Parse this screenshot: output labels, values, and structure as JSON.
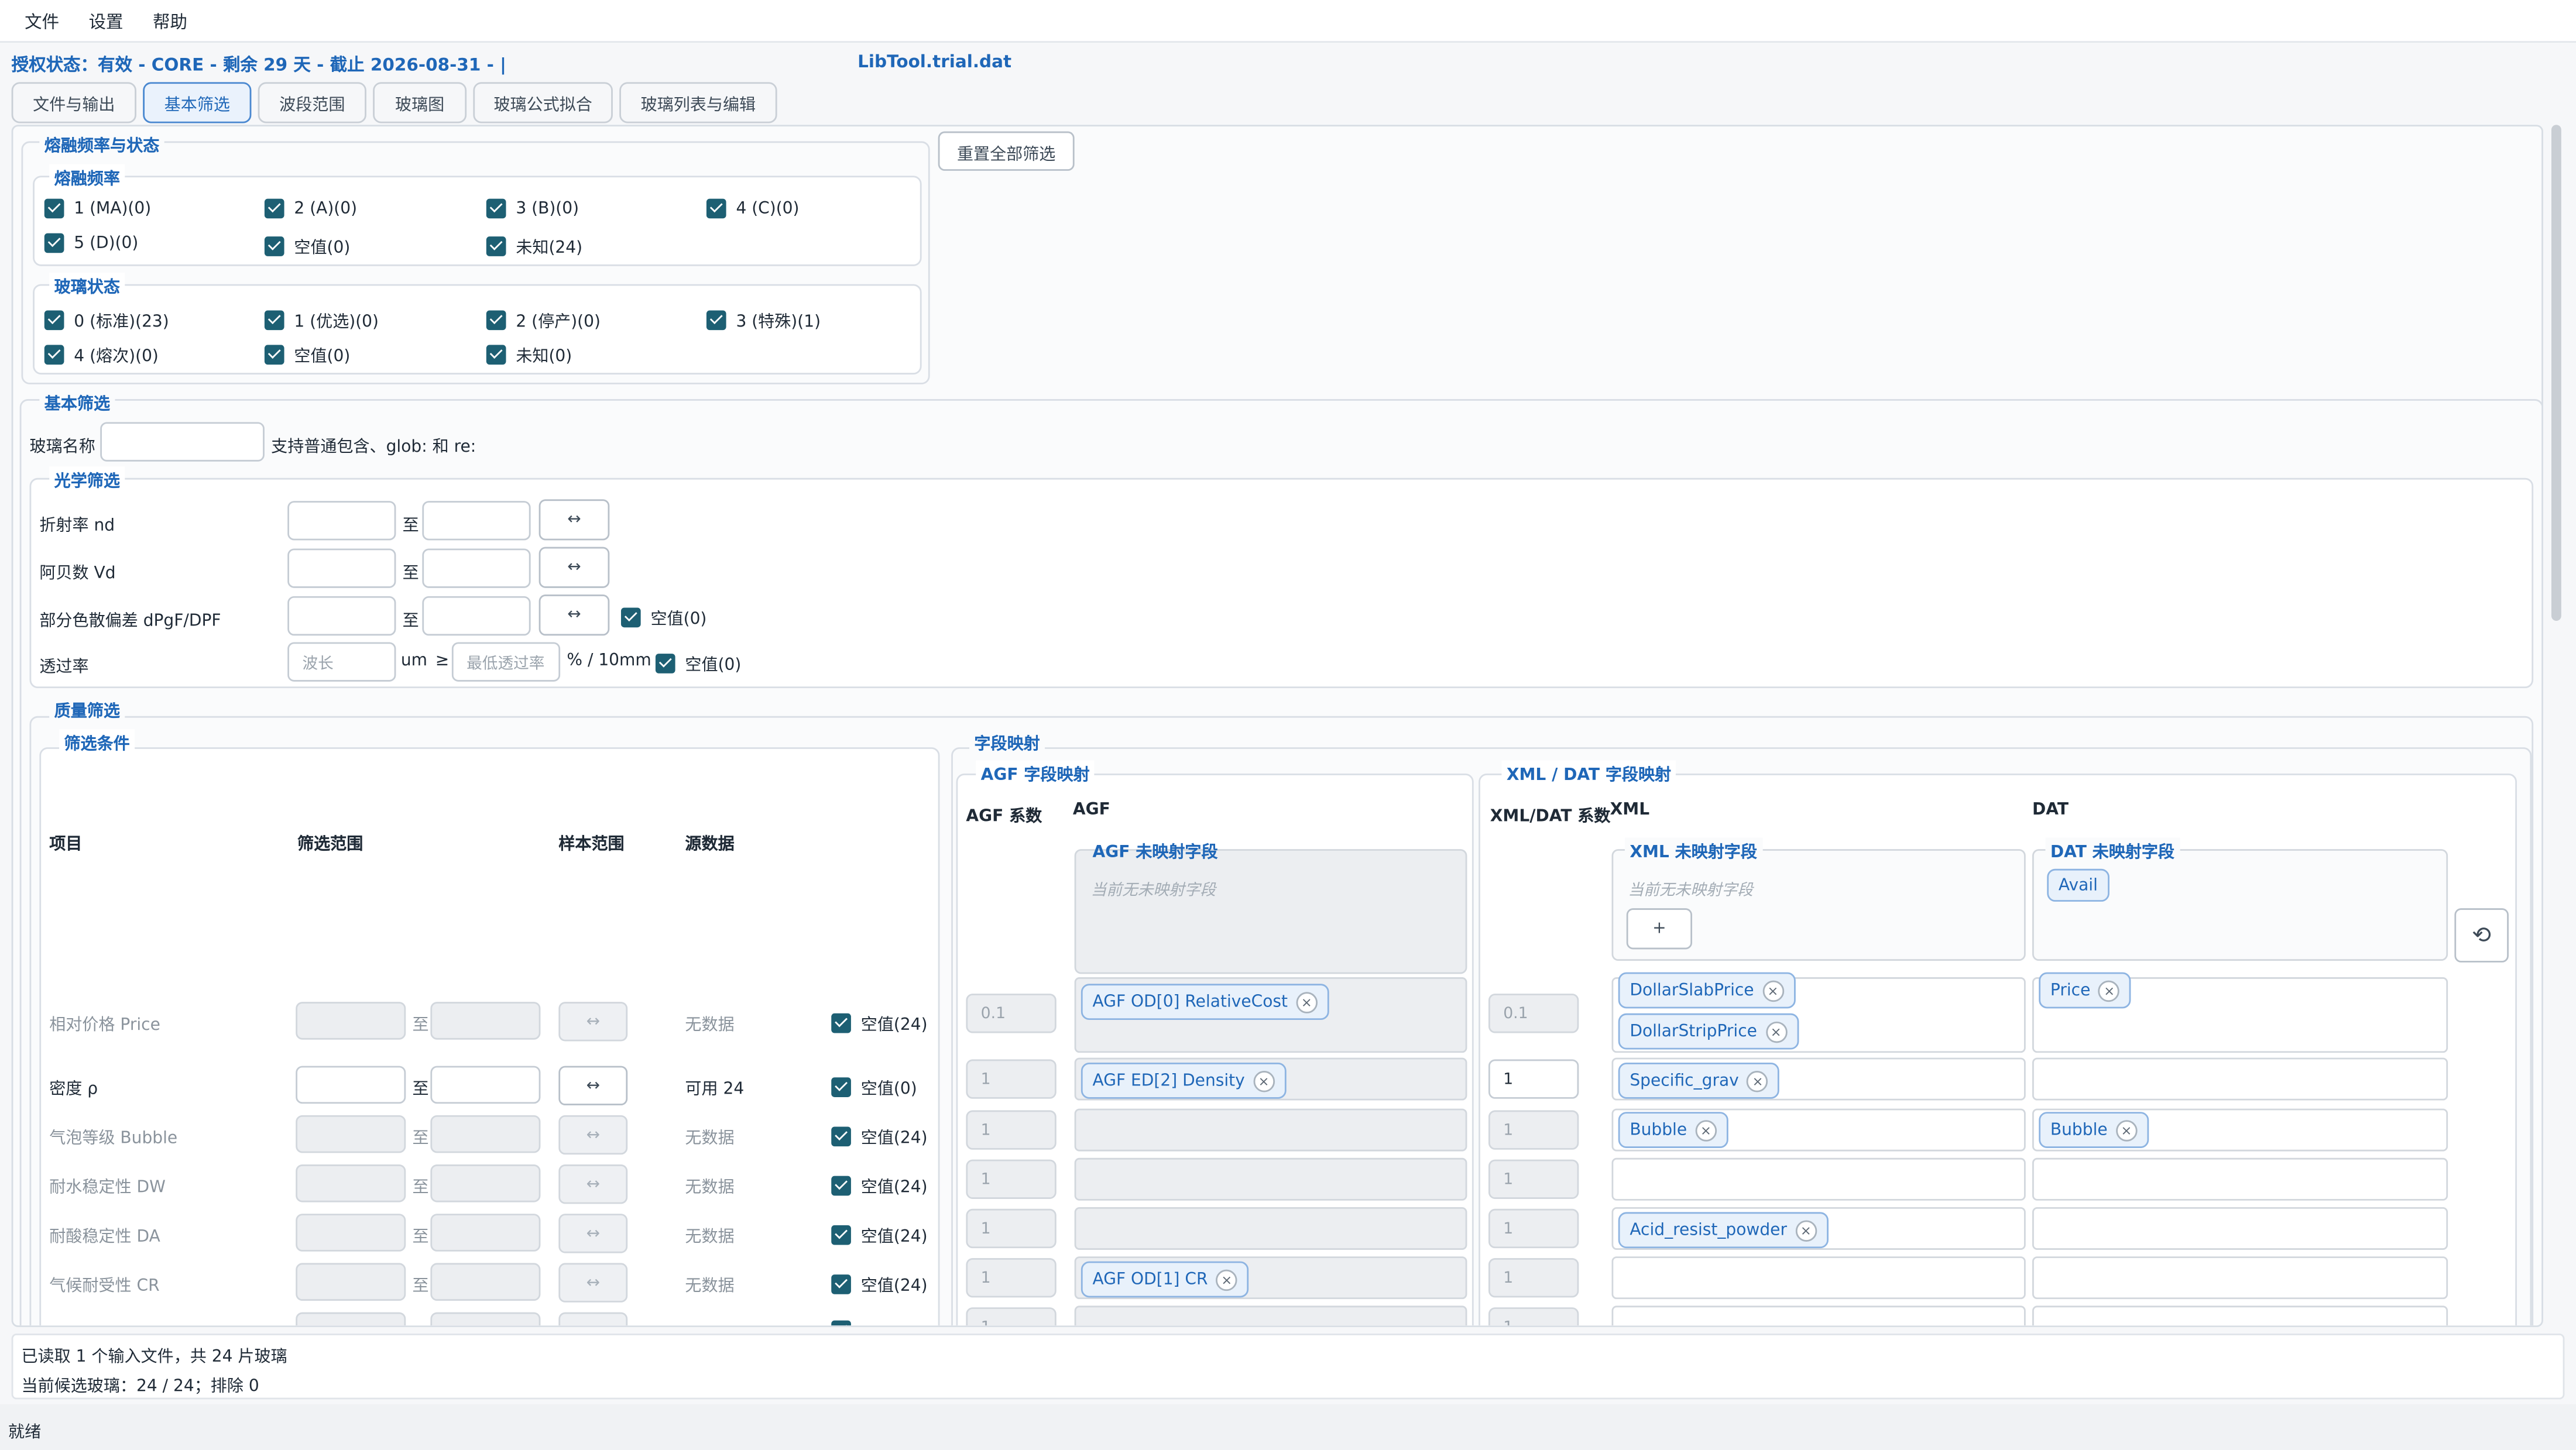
{
  "menu": [
    "文件",
    "设置",
    "帮助"
  ],
  "license": {
    "text": "授权状态：有效 - CORE - 剩余 29 天 - 截止 2026-08-31 - |",
    "file": "LibTool.trial.dat"
  },
  "tabs": [
    "文件与输出",
    "基本筛选",
    "波段范围",
    "玻璃图",
    "玻璃公式拟合",
    "玻璃列表与编辑"
  ],
  "active_tab": "基本筛选",
  "reset_all_label": "重置全部筛选",
  "melt_status": {
    "title": "熔融频率与状态",
    "freq_title": "熔融频率",
    "freq": [
      "1 (MA)(0)",
      "2 (A)(0)",
      "3 (B)(0)",
      "4 (C)(0)",
      "5 (D)(0)",
      "空值(0)",
      "未知(24)"
    ],
    "status_title": "玻璃状态",
    "status": [
      "0 (标准)(23)",
      "1 (优选)(0)",
      "2 (停产)(0)",
      "3 (特殊)(1)",
      "4 (熔次)(0)",
      "空值(0)",
      "未知(0)"
    ]
  },
  "basic": {
    "title": "基本筛选",
    "name_label": "玻璃名称",
    "name_hint": "支持普通包含、glob: 和 re:",
    "optical_title": "光学筛选",
    "to": "至",
    "swap": "↔",
    "rows": [
      {
        "label": "折射率 nd"
      },
      {
        "label": "阿贝数 Vd"
      },
      {
        "label": "部分色散偏差 dPgF/DPF",
        "empty": "空值(0)"
      }
    ],
    "transmission": {
      "label": "透过率",
      "wave_ph": "波长",
      "um": "um",
      "ge": "≥",
      "min_ph": "最低透过率",
      "unit": "% / 10mm",
      "empty": "空值(0)"
    }
  },
  "quality": {
    "title": "质量筛选",
    "cond_title": "筛选条件",
    "headers": [
      "项目",
      "筛选范围",
      "样本范围",
      "源数据"
    ],
    "rows": [
      {
        "name": "相对价格 Price",
        "to": "至",
        "swap": "↔",
        "src": "无数据",
        "empty": "空值(24)",
        "enabled": false,
        "agf_coef": "0.1",
        "xml_coef": "0.1"
      },
      {
        "name": "密度 ρ",
        "to": "至",
        "swap": "↔",
        "src": "可用 24",
        "empty": "空值(0)",
        "enabled": true,
        "agf_coef": "1",
        "xml_coef": "1"
      },
      {
        "name": "气泡等级 Bubble",
        "to": "至",
        "swap": "↔",
        "src": "无数据",
        "empty": "空值(24)",
        "enabled": false,
        "agf_coef": "1",
        "xml_coef": "1"
      },
      {
        "name": "耐水稳定性 DW",
        "to": "至",
        "swap": "↔",
        "src": "无数据",
        "empty": "空值(24)",
        "enabled": false,
        "agf_coef": "1",
        "xml_coef": "1"
      },
      {
        "name": "耐酸稳定性 DA",
        "to": "至",
        "swap": "↔",
        "src": "无数据",
        "empty": "空值(24)",
        "enabled": false,
        "agf_coef": "1",
        "xml_coef": "1"
      },
      {
        "name": "气候耐受性 CR",
        "to": "至",
        "swap": "↔",
        "src": "无数据",
        "empty": "空值(24)",
        "enabled": false,
        "agf_coef": "1",
        "xml_coef": "1"
      },
      {
        "name": "",
        "to": "",
        "swap": "",
        "src": "",
        "empty": "",
        "enabled": false,
        "agf_coef": "1",
        "xml_coef": "1"
      }
    ]
  },
  "mapping": {
    "title": "字段映射",
    "agf_title": "AGF 字段映射",
    "xml_title": "XML / DAT 字段映射",
    "agf_coef_hdr": "AGF 系数",
    "agf_hdr": "AGF",
    "xml_coef_hdr": "XML/DAT 系数",
    "xml_hdr": "XML",
    "dat_hdr": "DAT",
    "agf_unmapped_title": "AGF 未映射字段",
    "agf_unmapped_note": "当前无未映射字段",
    "xml_unmapped_title": "XML 未映射字段",
    "xml_unmapped_note": "当前无未映射字段",
    "add": "+",
    "dat_unmapped_title": "DAT 未映射字段",
    "dat_unmapped_chip": "Avail",
    "refresh": "⟲",
    "chips": {
      "agf_price": "AGF OD[0] RelativeCost",
      "agf_density": "AGF ED[2] Density",
      "agf_cr": "AGF OD[1] CR",
      "xml_price1": "DollarSlabPrice",
      "xml_price2": "DollarStripPrice",
      "dat_price": "Price",
      "xml_density": "Specific_grav",
      "xml_bubble": "Bubble",
      "dat_bubble": "Bubble",
      "xml_da": "Acid_resist_powder"
    },
    "x": "×"
  },
  "status": {
    "line1": "已读取 1 个输入文件，共 24 片玻璃",
    "line2": "当前候选玻璃：24 / 24；排除 0"
  },
  "bottom": "就绪"
}
